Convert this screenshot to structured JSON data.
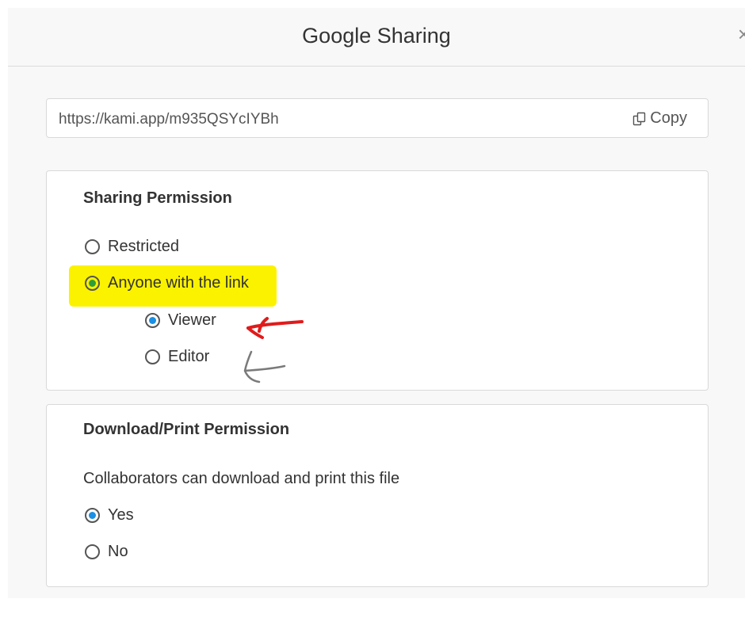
{
  "dialog": {
    "title": "Google Sharing",
    "close_symbol": "×"
  },
  "share_link": {
    "url": "https://kami.app/m935QSYcIYBh",
    "copy_label": "Copy",
    "copy_icon": "copy-icon"
  },
  "sharing_permission": {
    "title": "Sharing Permission",
    "options": [
      {
        "label": "Restricted",
        "checked": false
      },
      {
        "label": "Anyone with the link",
        "checked": true
      }
    ],
    "sub_options": [
      {
        "label": "Viewer",
        "checked": true
      },
      {
        "label": "Editor",
        "checked": false
      }
    ]
  },
  "download_permission": {
    "title": "Download/Print Permission",
    "description": "Collaborators can download and print this file",
    "options": [
      {
        "label": "Yes",
        "checked": true
      },
      {
        "label": "No",
        "checked": false
      }
    ]
  },
  "annotations": {
    "highlight_color": "#fbf200",
    "red_arrow_color": "#e01b1b",
    "gray_arrow_color": "#7a7a7a"
  },
  "colors": {
    "radio_checked": "#1a8fe3",
    "radio_checked_highlighted": "#2e9e3a"
  }
}
